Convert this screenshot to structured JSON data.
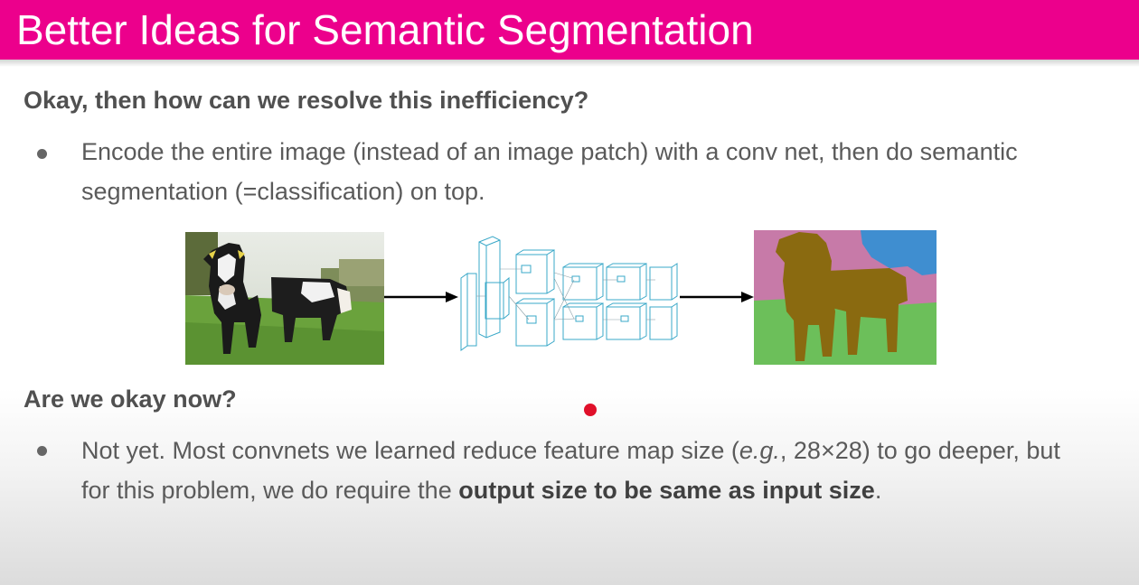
{
  "slide": {
    "title": "Better Ideas for Semantic Segmentation",
    "accent_color": "#ec008c",
    "section1": {
      "heading": "Okay, then how can we resolve this inefficiency?",
      "bullet": "Encode the entire image (instead of an image patch) with a conv net, then do semantic segmentation (=classification) on top."
    },
    "figure": {
      "input_image": "cow-photo",
      "network": "conv-net-diagram",
      "output_image": "segmentation-map",
      "segment_colors": {
        "cow": "#8a6a10",
        "grass": "#6cbf5a",
        "sky": "#3f8ed0",
        "trees": "#c77aa8"
      }
    },
    "section2": {
      "heading": "Are we okay now?",
      "bullet_part1": "Not yet. Most convnets we learned reduce feature map size (",
      "bullet_italic": "e.g.",
      "bullet_part2": ", 28×28) to go deeper, but for this problem, we do require the ",
      "bullet_bold": "output size to be same as input size",
      "bullet_part3": "."
    }
  }
}
